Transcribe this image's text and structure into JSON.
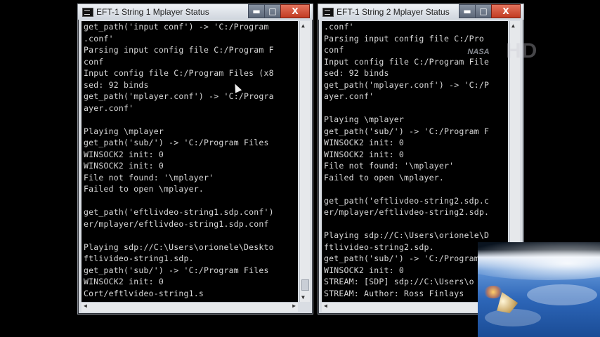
{
  "window1": {
    "title": "EFT-1 String 1 Mplayer Status",
    "minimize_label": "▬",
    "maximize_label": "□",
    "close_label": "X",
    "lines": [
      "get_path('input conf') -> 'C:/Program",
      ".conf'",
      "Parsing input config file C:/Program F",
      "conf",
      "Input config file C:/Program Files (x8",
      "sed: 92 binds",
      "get_path('mplayer.conf') -> 'C:/Progra",
      "ayer.conf'",
      "",
      "Playing \\mplayer",
      "get_path('sub/') -> 'C:/Program Files",
      "WINSOCK2 init: 0",
      "WINSOCK2 init: 0",
      "File not found: '\\mplayer'",
      "Failed to open \\mplayer.",
      "",
      "get_path('eftlivdeo-string1.sdp.conf')",
      "er/mplayer/eftlivdeo-string1.sdp.conf",
      "",
      "Playing sdp://C:\\Users\\orionele\\Deskto",
      "ftlivideo-string1.sdp.",
      "get_path('sub/') -> 'C:/Program Files",
      "WINSOCK2 init: 0",
      "Cort/eftlvideo-string1.s"
    ]
  },
  "window2": {
    "title": "EFT-1 String 2 Mplayer Status",
    "minimize_label": "▬",
    "maximize_label": "□",
    "close_label": "X",
    "lines": [
      ".conf'",
      "Parsing input config file C:/Pro",
      "conf",
      "Input config file C:/Program File",
      "sed: 92 binds",
      "get_path('mplayer.conf') -> 'C:/P",
      "ayer.conf'",
      "",
      "Playing \\mplayer",
      "get_path('sub/') -> 'C:/Program F",
      "WINSOCK2 init: 0",
      "WINSOCK2 init: 0",
      "File not found: '\\mplayer'",
      "Failed to open \\mplayer.",
      "",
      "get_path('eftlivdeo-string2.sdp.c",
      "er/mplayer/eftlivdeo-string2.sdp.",
      "",
      "Playing sdp://C:\\Users\\orionele\\D",
      "ftlivideo-string2.sdp.",
      "get_path('sub/') -> 'C:/Program F",
      "WINSOCK2 init: 0",
      "STREAM: [SDP] sdp://C:\\Users\\o",
      "STREAM: Author: Ross Finlays"
    ]
  },
  "overlay": {
    "hd_badge": "HD",
    "nasa_logo": "NASA"
  },
  "icons": {
    "window1_app": "console-icon",
    "window2_app": "console-icon"
  }
}
